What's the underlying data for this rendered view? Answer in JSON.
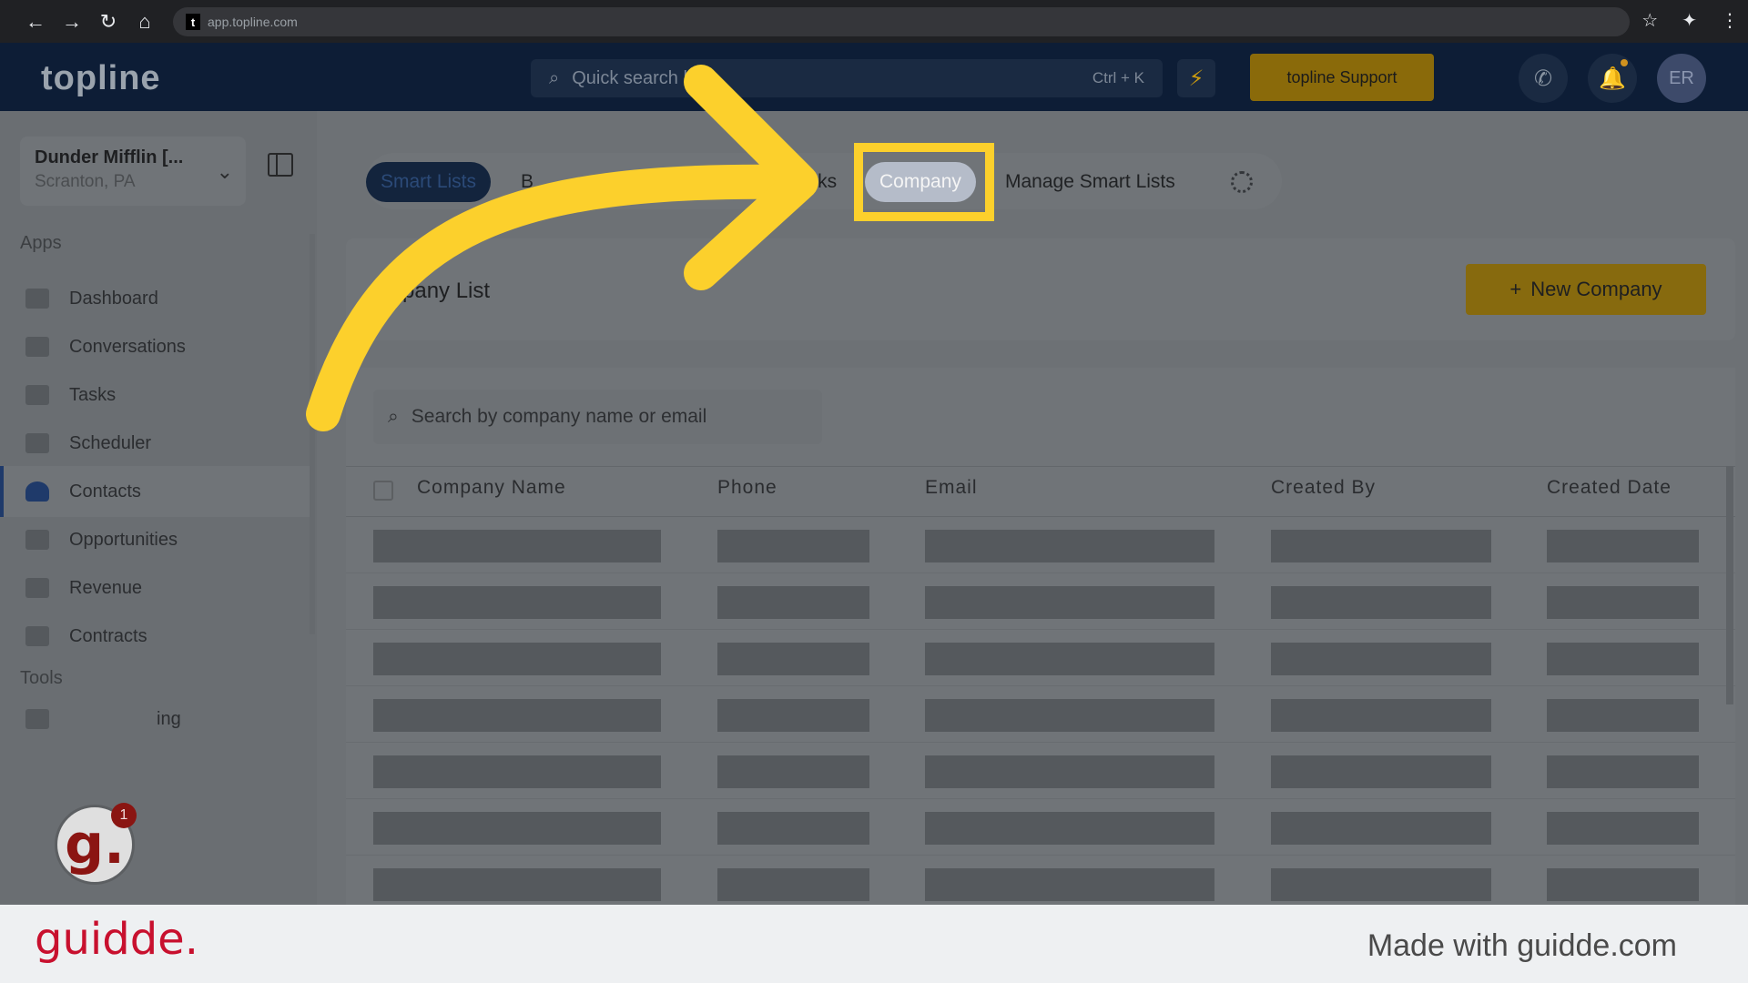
{
  "browser": {
    "url": "app.topline.com",
    "favicon_letter": "t",
    "nav": {
      "back": "←",
      "forward": "→",
      "reload": "↻",
      "home": "⌂"
    },
    "right": {
      "star": "☆",
      "extensions": "✦",
      "menu": "⋮"
    }
  },
  "header": {
    "logo": "topline",
    "search_placeholder": "Quick search here",
    "search_shortcut": "Ctrl + K",
    "bolt_icon": "⚡",
    "support_label": "topline Support",
    "phone_icon": "✆",
    "bell_icon": "🔔",
    "avatar_initials": "ER"
  },
  "sidebar": {
    "location_name": "Dunder Mifflin [...",
    "location_sub": "Scranton, PA",
    "apps_label": "Apps",
    "tools_label": "Tools",
    "items": [
      {
        "label": "Dashboard"
      },
      {
        "label": "Conversations"
      },
      {
        "label": "Tasks"
      },
      {
        "label": "Scheduler"
      },
      {
        "label": "Contacts"
      },
      {
        "label": "Opportunities"
      },
      {
        "label": "Revenue"
      },
      {
        "label": "Contracts"
      }
    ],
    "tools_item_partial": "ing",
    "guidde_badge_letter": "g.",
    "guidde_badge_count": "1"
  },
  "tabs": {
    "smart_lists": "Smart Lists",
    "bulk_partial": "B",
    "tasks_partial": "asks",
    "company": "Company",
    "manage": "Manage Smart Lists"
  },
  "main": {
    "list_title": "pany List",
    "new_company_label": "New Company",
    "new_company_icon": "+",
    "search_placeholder": "Search by company name or email",
    "columns": [
      "Company Name",
      "Phone",
      "Email",
      "Created By",
      "Created Date"
    ]
  },
  "footer": {
    "brand": "guidde.",
    "made_with": "Made with guidde.com"
  },
  "colors": {
    "highlight": "#fcd02c",
    "arrow": "#fcd02c",
    "brand_red": "#c8102e"
  }
}
